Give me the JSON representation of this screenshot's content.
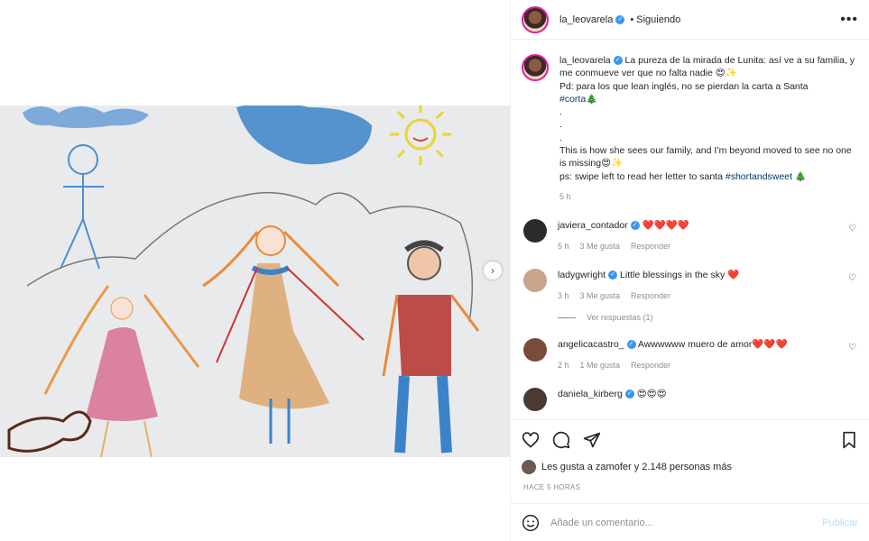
{
  "header": {
    "username": "la_leovarela",
    "follow_status": "Siguiendo",
    "more": "•••"
  },
  "caption": {
    "username": "la_leovarela",
    "line1": "La pureza de la mirada de Lunita: así ve a su familia, y me conmueve ver que no falta nadie 😍✨",
    "line2": "Pd: para los que lean inglés, no se pierdan la carta a Santa",
    "tag1": "#corta",
    "tree1": "🎄",
    "dot": ".",
    "line3": "This is how she sees our family, and I’m beyond moved to see no one is missing😍✨",
    "line4": "ps: swipe left to read her letter to santa",
    "tag2": "#shortandsweet",
    "tree2": "🎄",
    "time": "5 h"
  },
  "comments": [
    {
      "user": "javiera_contador",
      "text": "❤️❤️❤️❤️",
      "time": "5 h",
      "likes": "3 Me gusta",
      "reply": "Responder",
      "avatar_color": "#2b2b2b"
    },
    {
      "user": "ladygwright",
      "text": "Little blessings in the sky",
      "heart": "❤️",
      "time": "3 h",
      "likes": "3 Me gusta",
      "reply": "Responder",
      "avatar_color": "#c9a38b",
      "view_replies": "Ver respuestas (1)"
    },
    {
      "user": "angelicacastro_",
      "text": "Awwwwww muero de amor",
      "hearts": "❤️❤️❤️",
      "time": "2 h",
      "likes": "1 Me gusta",
      "reply": "Responder",
      "avatar_color": "#7a4a3a"
    },
    {
      "user": "daniela_kirberg",
      "text": "😍😍😍",
      "avatar_color": "#4a3a33"
    }
  ],
  "likes_text": "Les gusta a zamofer y 2.148 personas más",
  "timestamp": "HACE 5 HORAS",
  "add_comment": {
    "placeholder": "Añade un comentario...",
    "publish": "Publicar"
  },
  "icons": {
    "verified": "verified-badge-icon",
    "next": "chevron-right-icon"
  },
  "colors": {
    "link": "#00376b",
    "verified": "#3897f0",
    "heart": "#ed4956",
    "publish": "#b2dffc"
  }
}
